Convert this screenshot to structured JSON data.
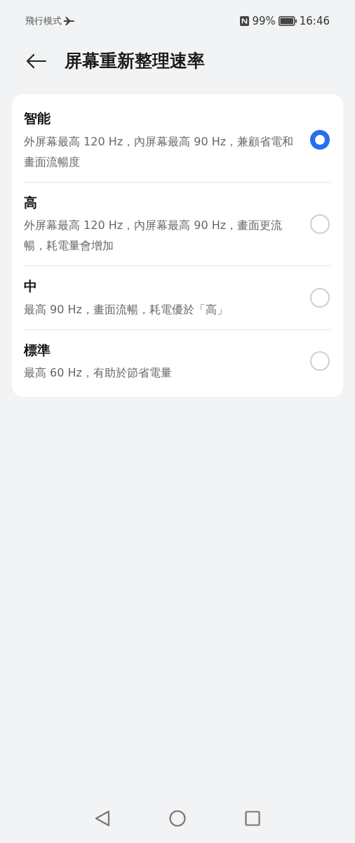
{
  "status_bar": {
    "mode": "飛行模式",
    "battery": "99%",
    "time": "16:46"
  },
  "header": {
    "title": "屏幕重新整理速率"
  },
  "options": [
    {
      "title": "智能",
      "description": "外屏幕最高 120 Hz，內屏幕最高 90 Hz，兼顧省電和畫面流暢度",
      "selected": true
    },
    {
      "title": "高",
      "description": "外屏幕最高 120 Hz，內屏幕最高 90 Hz，畫面更流暢，耗電量會增加",
      "selected": false
    },
    {
      "title": "中",
      "description": "最高 90 Hz，畫面流暢，耗電優於「高」",
      "selected": false
    },
    {
      "title": "標準",
      "description": "最高 60 Hz，有助於節省電量",
      "selected": false
    }
  ]
}
